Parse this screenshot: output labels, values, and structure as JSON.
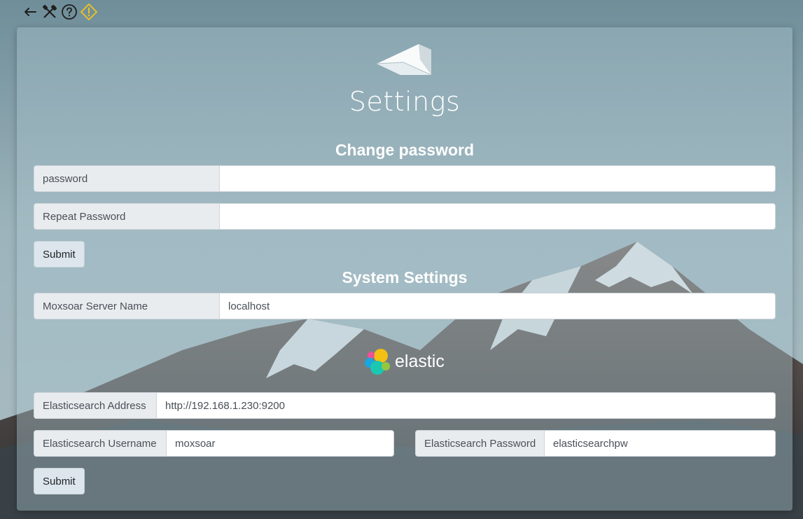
{
  "toolbar": {
    "icons": [
      "back-arrow-icon",
      "tools-icon",
      "help-icon",
      "warning-icon"
    ]
  },
  "page": {
    "title": "Settings"
  },
  "change_password": {
    "heading": "Change password",
    "password_label": "password",
    "password_value": "",
    "repeat_label": "Repeat Password",
    "repeat_value": "",
    "submit_label": "Submit"
  },
  "system_settings": {
    "heading": "System Settings",
    "server_name_label": "Moxsoar Server Name",
    "server_name_value": "localhost"
  },
  "elastic": {
    "brand": "elastic",
    "address_label": "Elasticsearch Address",
    "address_value": "http://192.168.1.230:9200",
    "username_label": "Elasticsearch Username",
    "username_value": "moxsoar",
    "password_label": "Elasticsearch Password",
    "password_value": "elasticsearchpw",
    "submit_label": "Submit"
  },
  "colors": {
    "card_bg": "#aac3cd",
    "addon_bg": "#e9ecef",
    "button_bg": "#dce6ec",
    "warning_icon": "#f2c31d"
  }
}
